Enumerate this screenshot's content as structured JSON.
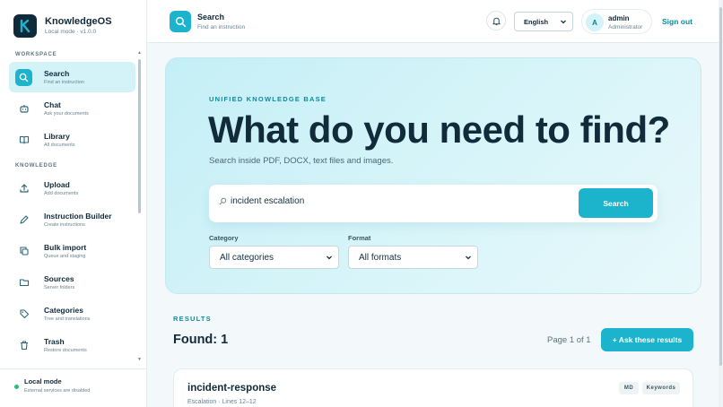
{
  "brand": {
    "name": "KnowledgeOS",
    "subtitle": "Local mode · v1.0.0"
  },
  "sidebar": {
    "sections": [
      {
        "label": "WORKSPACE"
      },
      {
        "label": "KNOWLEDGE"
      }
    ],
    "items": [
      {
        "title": "Search",
        "subtitle": "Find an instruction",
        "icon": "search-icon",
        "active": true
      },
      {
        "title": "Chat",
        "subtitle": "Ask your documents",
        "icon": "robot-icon",
        "active": false
      },
      {
        "title": "Library",
        "subtitle": "All documents",
        "icon": "book-icon",
        "active": false
      },
      {
        "title": "Upload",
        "subtitle": "Add documents",
        "icon": "upload-icon",
        "active": false
      },
      {
        "title": "Instruction Builder",
        "subtitle": "Create instructions",
        "icon": "pen-icon",
        "active": false
      },
      {
        "title": "Bulk import",
        "subtitle": "Queue and staging",
        "icon": "copy-icon",
        "active": false
      },
      {
        "title": "Sources",
        "subtitle": "Server folders",
        "icon": "folder-icon",
        "active": false
      },
      {
        "title": "Categories",
        "subtitle": "Tree and translations",
        "icon": "tag-icon",
        "active": false
      },
      {
        "title": "Trash",
        "subtitle": "Restore documents",
        "icon": "trash-icon",
        "active": false
      }
    ],
    "local_mode": {
      "title": "Local mode",
      "subtitle": "External services are disabled",
      "status_color": "#27c07a"
    }
  },
  "header": {
    "title": "Search",
    "subtitle": "Find an instruction",
    "language": "English",
    "user": {
      "initial": "A",
      "name": "admin",
      "role": "Administrator"
    },
    "signout": "Sign out"
  },
  "hero": {
    "eyebrow": "UNIFIED KNOWLEDGE BASE",
    "title": "What do you need to find?",
    "subtitle": "Search inside PDF, DOCX, text files and images.",
    "search": {
      "value": "incident escalation",
      "button": "Search"
    },
    "filters": {
      "category": {
        "label": "Category",
        "value": "All categories"
      },
      "format": {
        "label": "Format",
        "value": "All formats"
      }
    }
  },
  "results": {
    "label": "RESULTS",
    "found": "Found: 1",
    "page": "Page 1 of 1",
    "ask_button": "+ Ask these results",
    "items": [
      {
        "title": "incident-response",
        "meta": "Escalation · Lines 12–12",
        "tags": [
          "MD",
          "Keywords"
        ]
      }
    ]
  },
  "colors": {
    "accent": "#1bb4cc",
    "accent_dark": "#0e8aa0",
    "ink": "#112b3a"
  }
}
